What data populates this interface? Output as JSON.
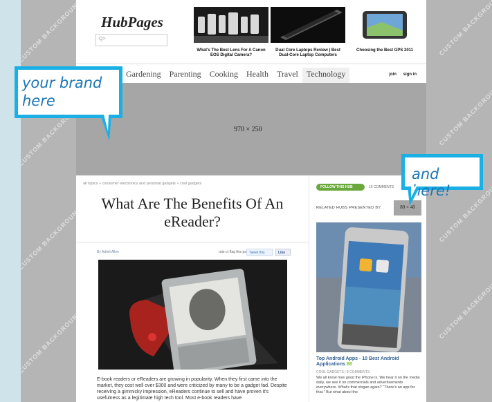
{
  "background": {
    "watermark_text": "CUSTOM BACKGROUND",
    "band_color": "#b5b5b5",
    "side_color": "#cfe3ea"
  },
  "header": {
    "logo": "HubPages",
    "search_placeholder": "Q>",
    "featured": [
      {
        "caption": "What's The Best Lens For A Canon EOS Digital Camera?",
        "icon": "camera-lenses-image"
      },
      {
        "caption": "Dual Core Laptops Review | Best Dual-Core Laptop Computers",
        "icon": "laptop-image"
      },
      {
        "caption": "Choosing the Best GPS 2011",
        "icon": "gps-device-image"
      }
    ]
  },
  "nav": {
    "items": [
      "Gardening",
      "Parenting",
      "Cooking",
      "Health",
      "Travel",
      "Technology"
    ],
    "active": "Technology",
    "join": "join",
    "sign_in": "sign in"
  },
  "ad_banner": {
    "label": "970 × 250"
  },
  "article": {
    "breadcrumb": "all topics » consumer electronics and personal gadgets » cool gadgets",
    "title": "What Are The Benefits Of An eReader?",
    "byline": "By Admit Allen",
    "rate_label": "rate or flag this page",
    "tweet_label": "Tweet this",
    "like_label": "Like",
    "body": "E-book readers or eReaders are growing in popularity. When they first came into the market, they cost well over $300 and were criticized by many to be a gadget fad. Despite receiving a gimmicky impression, eReaders continue to sell and have proven it's usefulness as a legitimate high tech tool. Most e-book readers have"
  },
  "sidebar": {
    "follow_label": "FOLLOW THIS HUB",
    "comments_label": "16 COMMENTS",
    "related_label": "RELATED HUBS PRESENTED BY",
    "mini_ad_label": "80 × 40",
    "hub_title": "Top Android Apps - 10 Best Android Applications",
    "hub_badge": "88",
    "hub_meta": "COOL GADGETS | 8 COMMENTS",
    "hub_desc": "We all know how good the iPhone is. We hear it on the media daily, we see it on commercials and advertisements everywhere. What's that slogan again? \"There's an app for that.\" But what about the"
  },
  "callouts": {
    "brand": "your brand here",
    "here": "and here!",
    "accent": "#1ab0e5",
    "text_color": "#1b76b6"
  }
}
